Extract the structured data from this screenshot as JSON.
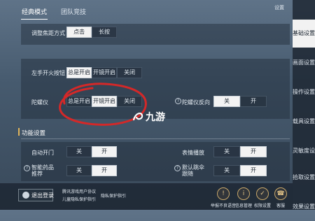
{
  "tabs": [
    {
      "label": "经典模式",
      "active": true
    },
    {
      "label": "团队竞技",
      "active": false
    }
  ],
  "top_right": "设置",
  "sidebar": {
    "items": [
      {
        "label": "基础设置",
        "active": true
      },
      {
        "label": "画面设置",
        "active": false
      },
      {
        "label": "操作设置",
        "active": false
      },
      {
        "label": "载具设置",
        "active": false
      },
      {
        "label": "灵敏度设置",
        "active": false
      },
      {
        "label": "拾取设置",
        "active": false
      },
      {
        "label": "效果设置",
        "active": false
      }
    ]
  },
  "settings": {
    "focus": {
      "label": "调整焦距方式",
      "options": [
        "点击",
        "长按"
      ],
      "selected": 0
    },
    "left_fire": {
      "label": "左手开火按钮",
      "options": [
        "总是开启",
        "开镜开启",
        "关闭"
      ],
      "selected": 0
    },
    "gyro": {
      "label": "陀螺仪",
      "options": [
        "总是开启",
        "开镜开启",
        "关闭"
      ],
      "selected": 1
    },
    "gyro_reverse": {
      "label": "陀螺仪反向",
      "options": [
        "关",
        "开"
      ],
      "selected": 0
    },
    "function_section": "功能设置",
    "auto_door": {
      "label": "自动开门",
      "options": [
        "关",
        "开"
      ],
      "selected": 1
    },
    "emote": {
      "label": "表情播放",
      "options": [
        "关",
        "开"
      ],
      "selected": 1
    },
    "smart_med": {
      "label": "智能药品推荐",
      "label_line1": "智能药品",
      "label_line2": "推荐",
      "options": [
        "关",
        "开"
      ],
      "selected": 1
    },
    "follow_parachute": {
      "label": "默认跳伞跟随",
      "label_line1": "默认跳伞",
      "label_line2": "跟随",
      "options": [
        "关",
        "开"
      ],
      "selected": 1
    }
  },
  "watermark": "九游",
  "bottom": {
    "logout": "退出登录",
    "links": [
      "腾讯游戏用户协议",
      "儿童隐私保护指引",
      "隐私保护指引"
    ],
    "buttons": [
      {
        "label": "举报不良语音",
        "icon": "report-icon"
      },
      {
        "label": "信息管理",
        "icon": "info-icon"
      },
      {
        "label": "权限设置",
        "icon": "permission-icon"
      },
      {
        "label": "客服",
        "icon": "service-icon"
      }
    ]
  }
}
